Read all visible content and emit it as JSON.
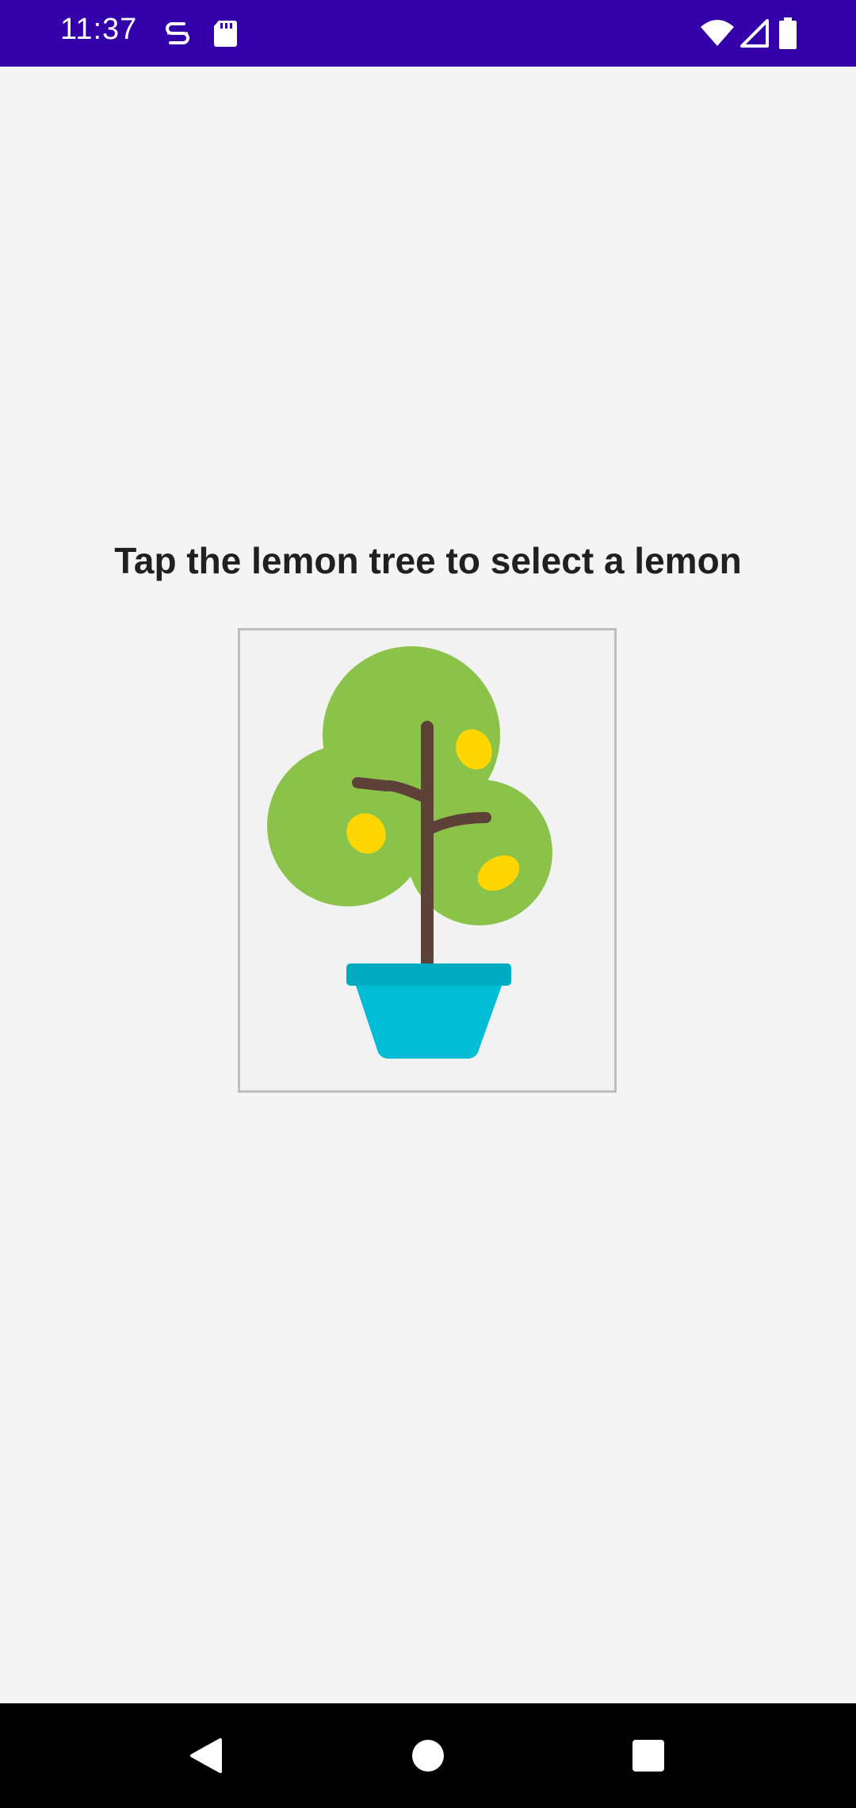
{
  "status_bar": {
    "time": "11:37",
    "background_color": "#3300aa",
    "icons": [
      "s-notification-icon",
      "sd-card-icon",
      "wifi-icon",
      "signal-icon",
      "battery-icon"
    ]
  },
  "main": {
    "prompt": "Tap the lemon tree to select a lemon",
    "image_description_icon": "lemon-tree-icon"
  },
  "nav_bar": {
    "icons": [
      "back-icon",
      "home-icon",
      "recents-icon"
    ]
  },
  "colors": {
    "foliage": "#8bc34a",
    "lemon": "#ffd600",
    "trunk": "#5d4037",
    "pot": "#00bcd4"
  }
}
